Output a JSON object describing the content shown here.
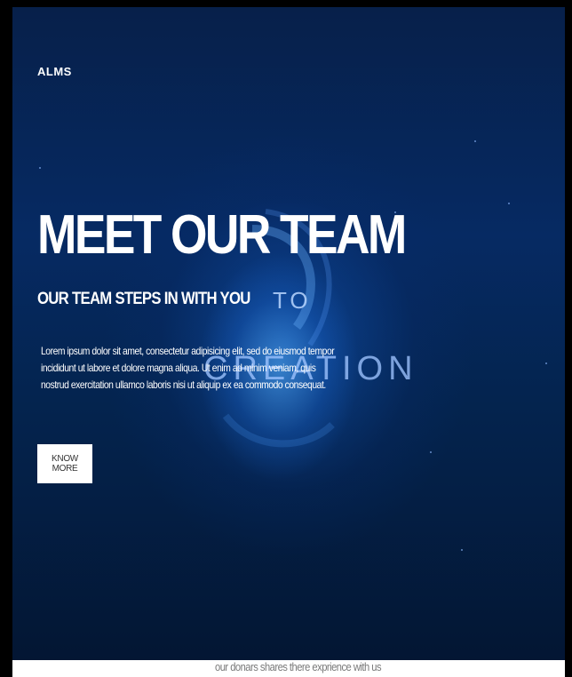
{
  "brand": {
    "logo": "ALMS"
  },
  "hero": {
    "title": "MEET OUR TEAM",
    "subtitle": "OUR TEAM STEPS IN WITH YOU",
    "background_word_1": "TO",
    "background_word_2": "CREATION",
    "body": "Lorem ipsum dolor sit amet, consectetur adipisicing elit, sed do eiusmod tempor incididunt ut labore et dolore magna aliqua. Ut enim ad minim veniam, quis nostrud exercitation ullamco laboris nisi ut aliquip ex ea commodo consequat.",
    "button_label": "KNOW MORE"
  },
  "footer_section": {
    "caption": "our donars shares there exprience with us"
  },
  "colors": {
    "background_dark": "#062a63",
    "glow": "#5ab4ff",
    "text": "#ffffff",
    "button_bg": "#ffffff",
    "button_text": "#333333"
  }
}
